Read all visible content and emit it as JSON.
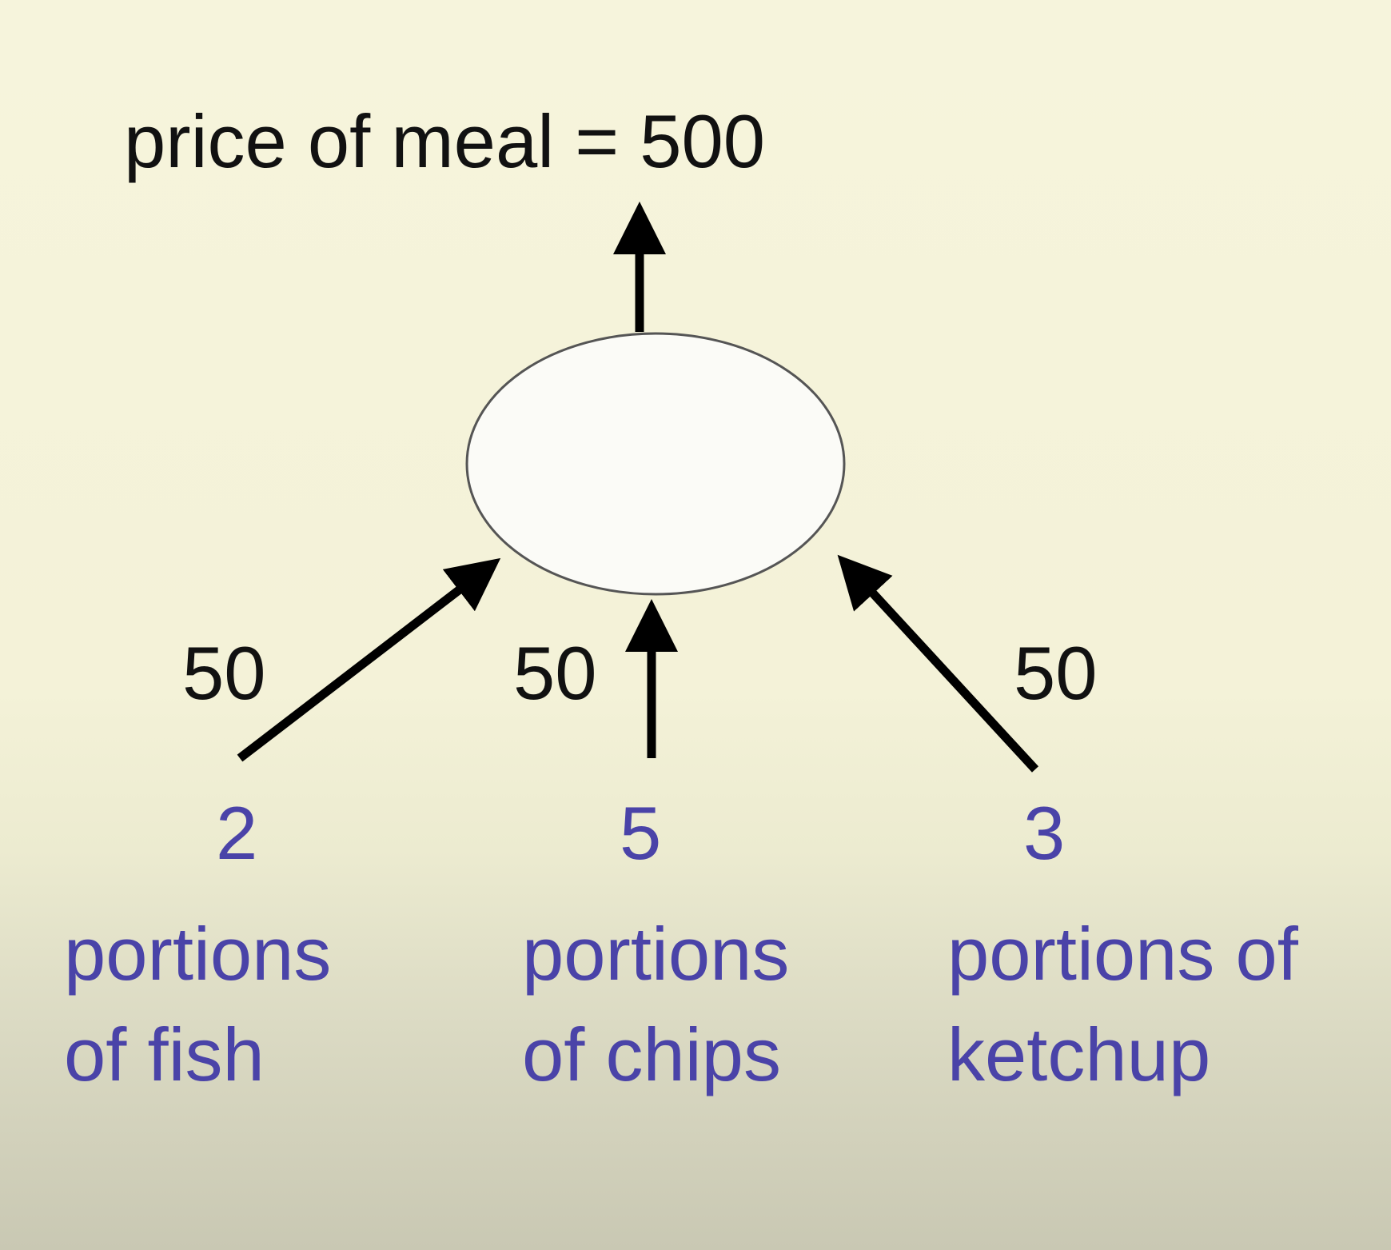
{
  "title": "price of meal = 500",
  "inputs": [
    {
      "weight": "50",
      "quantity": "2",
      "label_line1": "portions",
      "label_line2": "of fish"
    },
    {
      "weight": "50",
      "quantity": "5",
      "label_line1": "portions",
      "label_line2": "of chips"
    },
    {
      "weight": "50",
      "quantity": "3",
      "label_line1": "portions of",
      "label_line2": "ketchup"
    }
  ],
  "colors": {
    "text": "#111111",
    "input_text": "#4a43a8",
    "neuron_fill": "#fbfbf7",
    "neuron_stroke": "#555555",
    "arrow": "#000000"
  }
}
